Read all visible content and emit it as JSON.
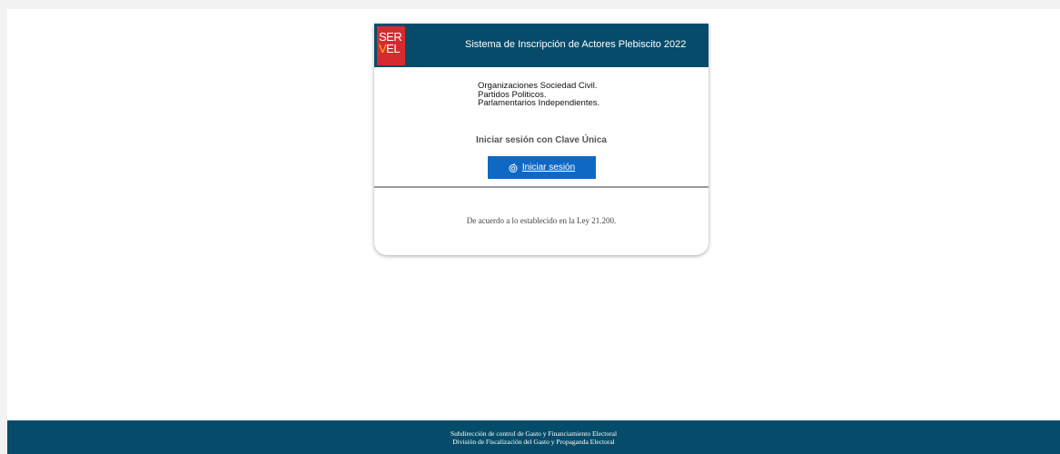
{
  "header": {
    "logo_line1": "SER",
    "logo_line2_v": "V",
    "logo_line2_rest": "EL",
    "title": "Sistema de Inscripción de Actores Plebiscito 2022"
  },
  "organizations": [
    "Organizaciones Sociedad Civil.",
    "Partidos Politicos.",
    "Parlamentarios Independientes."
  ],
  "login": {
    "caption": "Iniciar sesión con Clave Única",
    "button_label": "Iniciar sesión",
    "button_icon": "clave-unica-icon"
  },
  "law_text": "De acuerdo a lo establecido en la Ley 21.200.",
  "footer": {
    "line1": "Subdirección de control de Gasto y Financiamiento Electoral",
    "line2": "División de Fiscalización del Gasto y Propaganda Electoral"
  },
  "colors": {
    "header_bg": "#064c6a",
    "logo_red": "#d52b2f",
    "logo_yellow": "#f5c400",
    "button_blue": "#0f69c4"
  }
}
